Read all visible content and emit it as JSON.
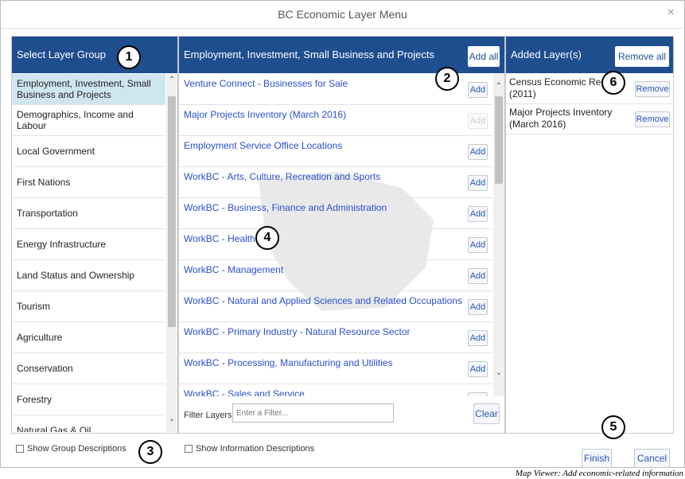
{
  "dialog": {
    "title": "BC Economic Layer Menu",
    "close_glyph": "×"
  },
  "left_panel": {
    "header": "Select Layer Group",
    "groups": [
      {
        "label": "Employment, Investment, Small Business and Projects",
        "selected": true
      },
      {
        "label": "Demographics, Income and Labour"
      },
      {
        "label": "Local Government"
      },
      {
        "label": "First Nations"
      },
      {
        "label": "Transportation"
      },
      {
        "label": "Energy Infrastructure"
      },
      {
        "label": "Land Status and Ownership"
      },
      {
        "label": "Tourism"
      },
      {
        "label": "Agriculture"
      },
      {
        "label": "Conservation"
      },
      {
        "label": "Forestry"
      },
      {
        "label": "Natural Gas & Oil"
      }
    ],
    "show_descriptions_label": "Show Group Descriptions"
  },
  "middle_panel": {
    "header": "Employment, Investment, Small Business and Projects",
    "add_all_label": "Add all",
    "layers": [
      {
        "label": "Venture Connect - Businesses for Sale",
        "add_label": "Add",
        "disabled": false
      },
      {
        "label": "Major Projects Inventory (March 2016)",
        "add_label": "Add",
        "disabled": true
      },
      {
        "label": "Employment Service Office Locations",
        "add_label": "Add",
        "disabled": false
      },
      {
        "label": "WorkBC - Arts, Culture, Recreation and Sports",
        "add_label": "Add",
        "disabled": false
      },
      {
        "label": "WorkBC - Business, Finance and Administration",
        "add_label": "Add",
        "disabled": false
      },
      {
        "label": "WorkBC - Health",
        "add_label": "Add",
        "disabled": false
      },
      {
        "label": "WorkBC - Management",
        "add_label": "Add",
        "disabled": false
      },
      {
        "label": "WorkBC - Natural and Applied Sciences and Related Occupations",
        "add_label": "Add",
        "disabled": false
      },
      {
        "label": "WorkBC - Primary Industry - Natural Resource Sector",
        "add_label": "Add",
        "disabled": false
      },
      {
        "label": "WorkBC - Processing, Manufacturing and Utilities",
        "add_label": "Add",
        "disabled": false
      },
      {
        "label": "WorkBC - Sales and Service",
        "add_label": "Add",
        "disabled": false
      }
    ],
    "filter_label": "Filter Layers",
    "filter_placeholder": "Enter a Filter...",
    "clear_label": "Clear",
    "show_descriptions_label": "Show Information Descriptions"
  },
  "right_panel": {
    "header": "Added Layer(s)",
    "remove_all_label": "Remove all",
    "added": [
      {
        "label": "Census Economic Regions (2011)",
        "remove_label": "Remove"
      },
      {
        "label": "Major Projects Inventory (March 2016)",
        "remove_label": "Remove"
      }
    ],
    "finish_label": "Finish",
    "cancel_label": "Cancel"
  },
  "callouts": [
    "1",
    "2",
    "3",
    "4",
    "5",
    "6"
  ],
  "caption": "Map Viewer:  Add economic-related information",
  "colors": {
    "header_bg": "#1f4e8f",
    "link": "#2a4fd0",
    "selected_row": "#cfe6f0"
  }
}
